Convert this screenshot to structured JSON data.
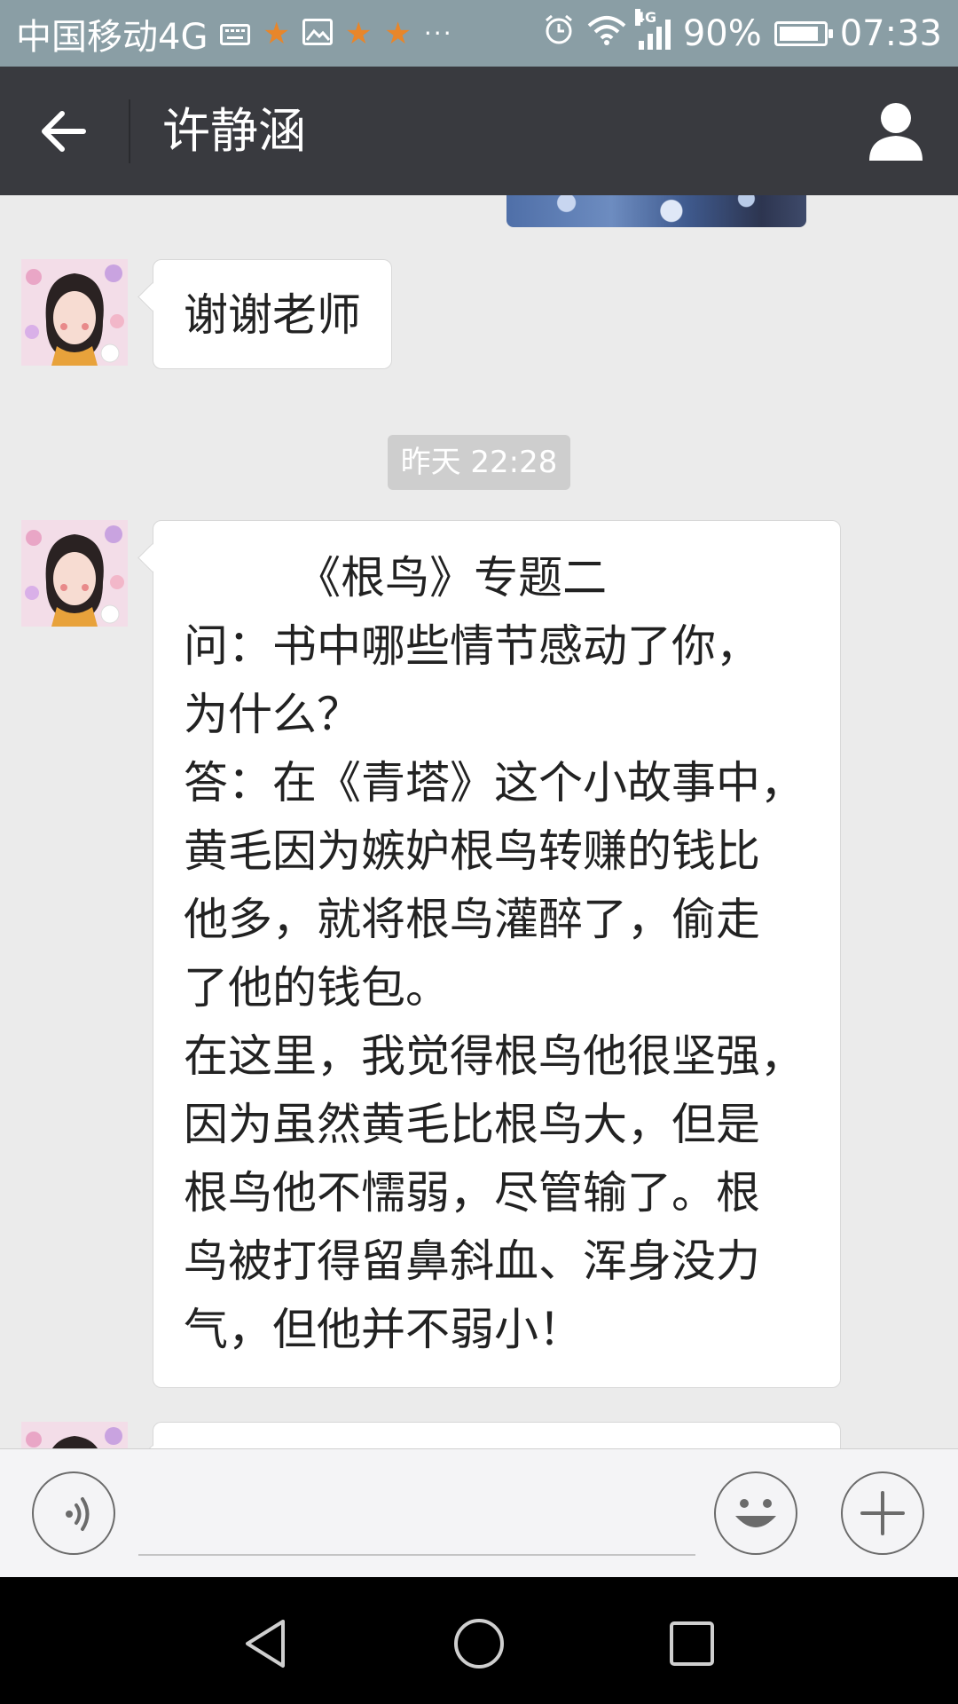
{
  "status_bar": {
    "carrier": "中国移动4G",
    "network_type": "4G",
    "battery_percent": "90%",
    "battery_level": 0.9,
    "time": "07:33",
    "icons": [
      "keyboard-icon",
      "star-icon",
      "image-icon",
      "star-icon",
      "star-icon",
      "more-dots-icon",
      "alarm-icon",
      "wifi-icon",
      "signal-icon",
      "battery-icon"
    ],
    "more_dots": "···"
  },
  "header": {
    "title": "许静涵",
    "back_icon": "arrow-left-icon",
    "profile_icon": "person-icon"
  },
  "messages": [
    {
      "type": "image",
      "direction": "outgoing"
    },
    {
      "type": "text",
      "direction": "incoming",
      "text": "谢谢老师"
    },
    {
      "type": "timestamp",
      "text": "昨天 22:28"
    },
    {
      "type": "text",
      "direction": "incoming",
      "lines": [
        "        《根鸟》专题二",
        "问：书中哪些情节感动了你，",
        "为什么？",
        "答：在《青塔》这个小故事中，",
        "黄毛因为嫉妒根鸟转赚的钱比",
        "他多，就将根鸟灌醉了，偷走",
        "了他的钱包。",
        "在这里，我觉得根鸟他很坚强，",
        "因为虽然黄毛比根鸟大，但是",
        "根鸟他不懦弱，尽管输了。根",
        "鸟被打得留鼻斜血、浑身没力",
        "气，但他并不弱小！"
      ]
    },
    {
      "type": "text",
      "direction": "incoming",
      "partial": true
    }
  ],
  "input_bar": {
    "placeholder": "",
    "value": "",
    "icons": [
      "voice-icon",
      "emoji-icon",
      "plus-icon"
    ]
  },
  "nav_bar": {
    "icons": [
      "nav-back-icon",
      "nav-home-icon",
      "nav-recent-icon"
    ]
  },
  "colors": {
    "status_bar": "#8a9ea5",
    "title_bar": "#393a3f",
    "chat_bg": "#ebebeb",
    "timestamp_bg": "#cecece"
  }
}
